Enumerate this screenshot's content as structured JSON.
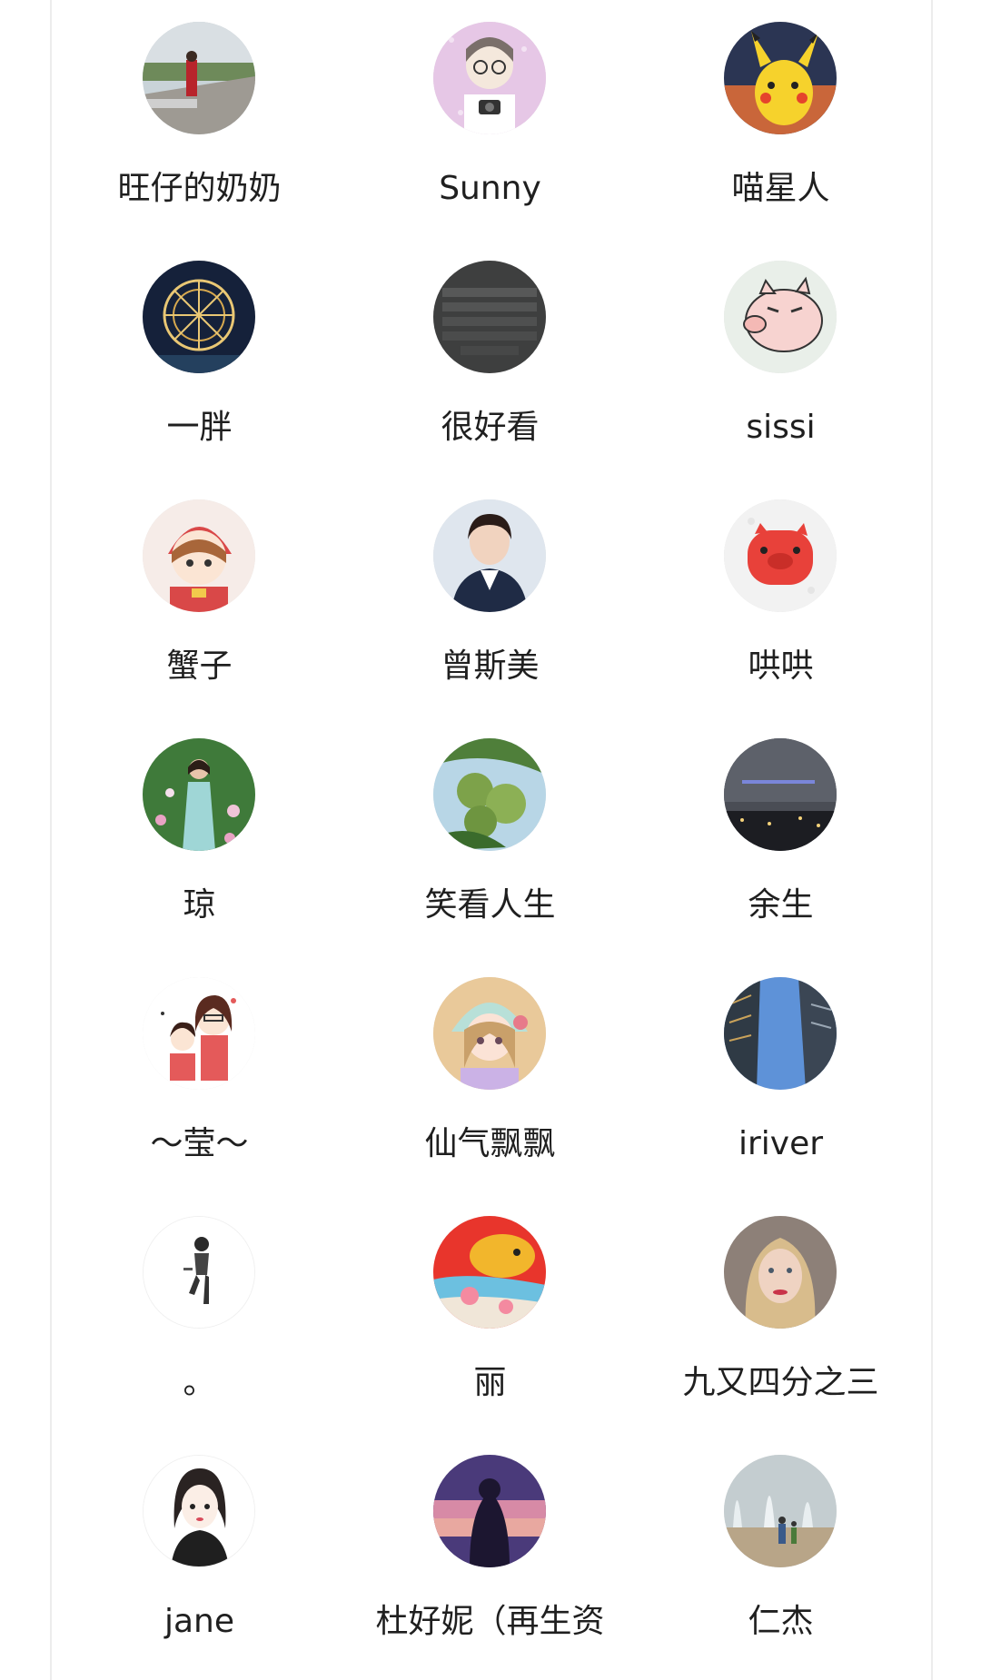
{
  "members": [
    {
      "name": "旺仔的奶奶",
      "avatar_icon": "woman-lakeside-photo-avatar"
    },
    {
      "name": "Sunny",
      "avatar_icon": "cartoon-girl-camera-avatar"
    },
    {
      "name": "喵星人",
      "avatar_icon": "pikachu-avatar"
    },
    {
      "name": "一胖",
      "avatar_icon": "light-sculpture-sphere-avatar"
    },
    {
      "name": "很好看",
      "avatar_icon": "keyboard-photo-avatar"
    },
    {
      "name": "sissi",
      "avatar_icon": "cartoon-pig-avatar"
    },
    {
      "name": "蟹子",
      "avatar_icon": "cartoon-girl-red-hat-avatar"
    },
    {
      "name": "曾斯美",
      "avatar_icon": "woman-in-suit-portrait-avatar"
    },
    {
      "name": "哄哄",
      "avatar_icon": "red-pig-sticker-avatar"
    },
    {
      "name": "琼",
      "avatar_icon": "woman-in-flower-field-avatar"
    },
    {
      "name": "笑看人生",
      "avatar_icon": "green-fruits-avatar"
    },
    {
      "name": "余生",
      "avatar_icon": "night-city-lights-avatar"
    },
    {
      "name": "～莹～",
      "avatar_icon": "cartoon-mother-daughter-avatar"
    },
    {
      "name": "仙气飘飘",
      "avatar_icon": "anime-girl-bonnet-avatar"
    },
    {
      "name": "iriver",
      "avatar_icon": "skyscrapers-sky-avatar"
    },
    {
      "name": "。",
      "avatar_icon": "sketch-girl-sitting-avatar"
    },
    {
      "name": "丽",
      "avatar_icon": "red-koi-fish-painting-avatar"
    },
    {
      "name": "九又四分之三",
      "avatar_icon": "blonde-woman-selfie-avatar"
    },
    {
      "name": "jane",
      "avatar_icon": "cartoon-girl-black-hair-avatar"
    },
    {
      "name": "杜好妮（再生资",
      "avatar_icon": "sunset-silhouette-avatar"
    },
    {
      "name": "仁杰",
      "avatar_icon": "fountain-children-avatar"
    }
  ]
}
